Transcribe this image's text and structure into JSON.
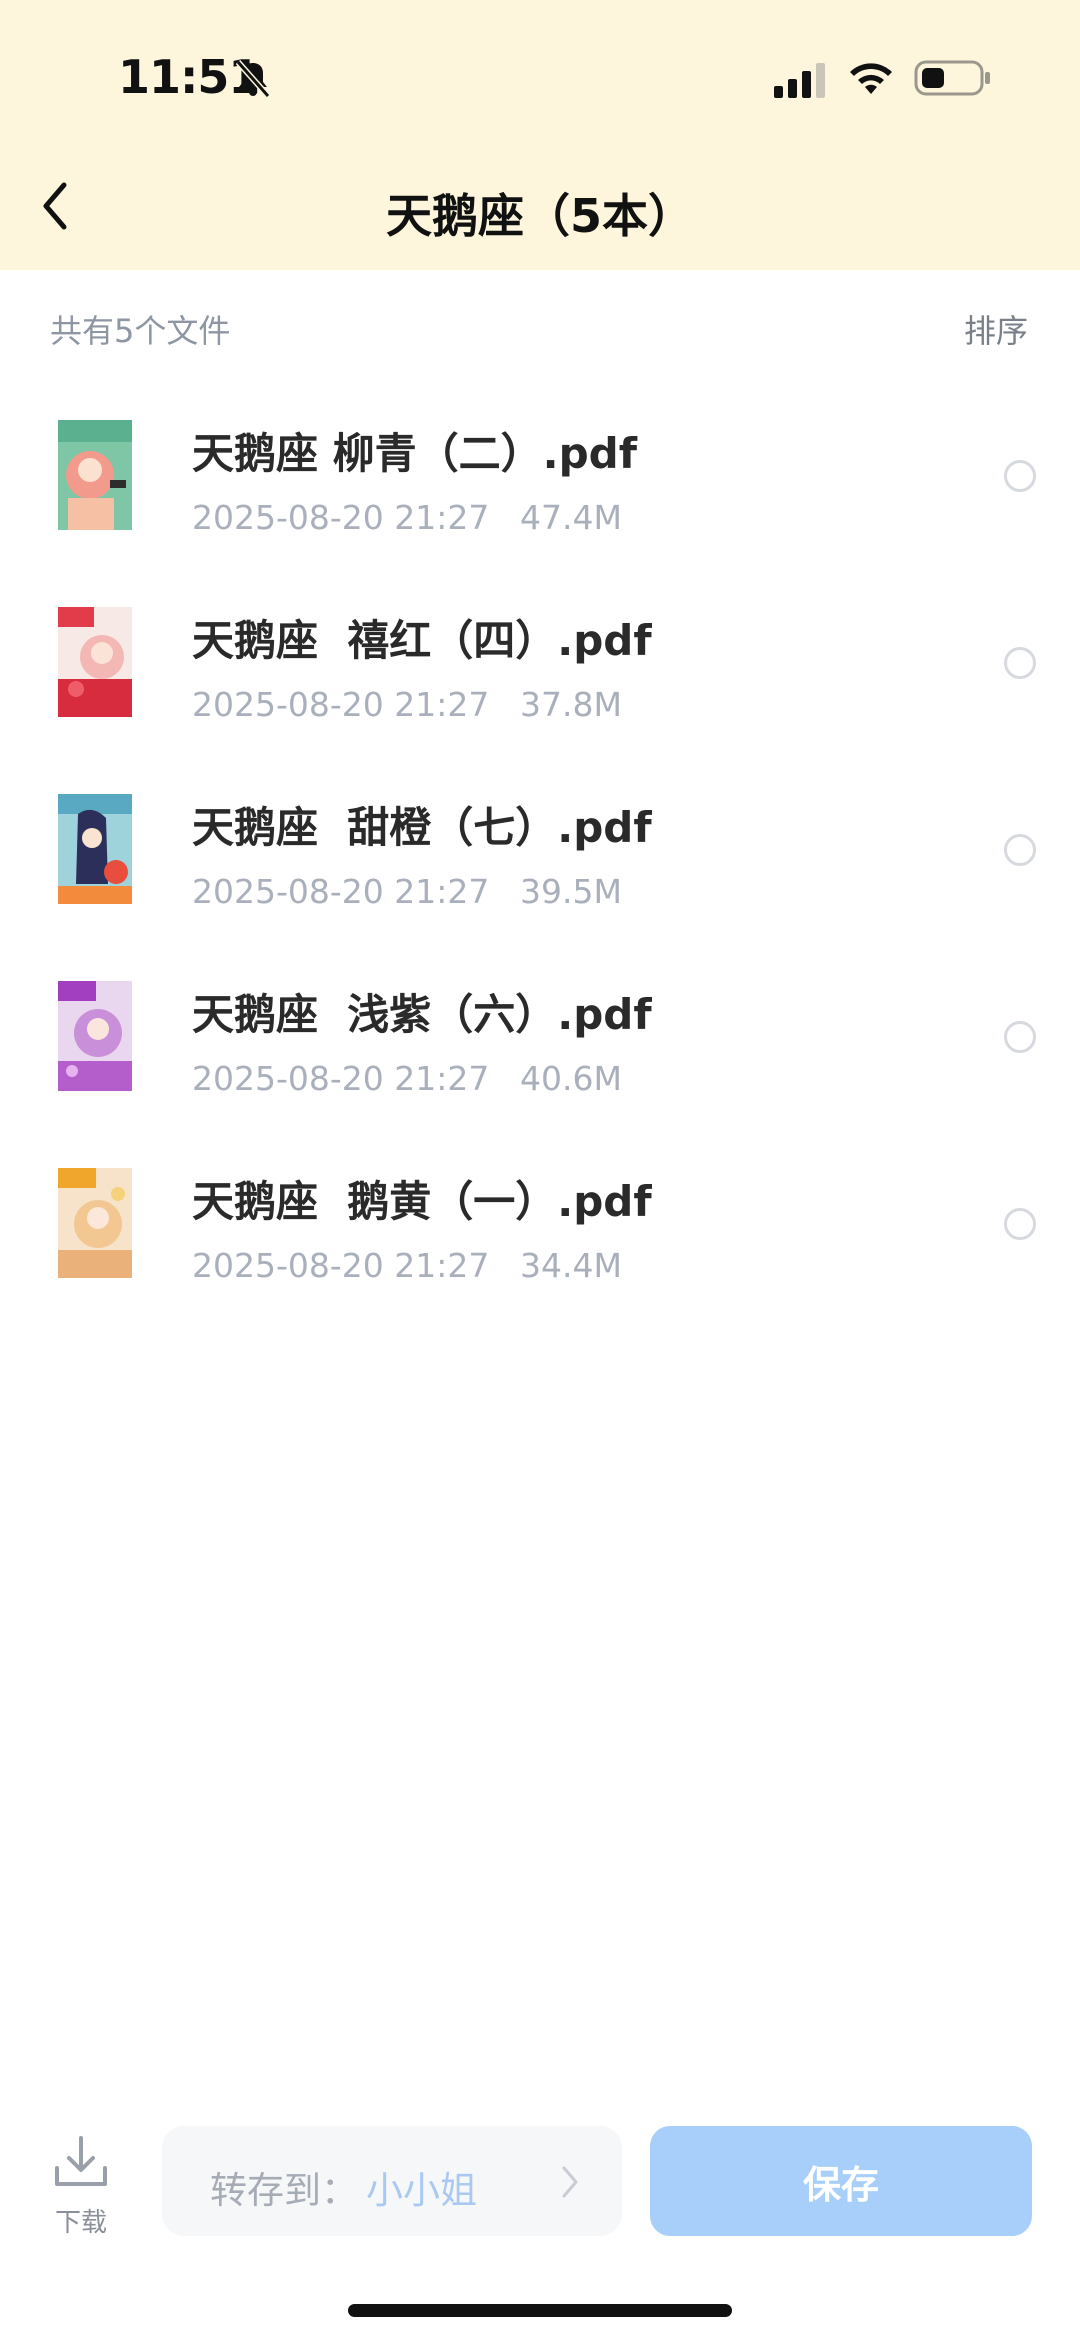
{
  "status_bar": {
    "time": "11:51"
  },
  "header": {
    "title": "天鹅座（5本）"
  },
  "summary": {
    "count_text": "共有5个文件",
    "sort_label": "排序"
  },
  "files": [
    {
      "name": "天鹅座 柳青（二）.pdf",
      "date": "2025-08-20 21:27",
      "size": "47.4M"
    },
    {
      "name": "天鹅座  禧红（四）.pdf",
      "date": "2025-08-20 21:27",
      "size": "37.8M"
    },
    {
      "name": "天鹅座  甜橙（七）.pdf",
      "date": "2025-08-20 21:27",
      "size": "39.5M"
    },
    {
      "name": "天鹅座  浅紫（六）.pdf",
      "date": "2025-08-20 21:27",
      "size": "40.6M"
    },
    {
      "name": "天鹅座  鹅黄（一）.pdf",
      "date": "2025-08-20 21:27",
      "size": "34.4M"
    }
  ],
  "bottom_bar": {
    "download_label": "下载",
    "transfer_label": "转存到：",
    "transfer_target": "小小姐",
    "save_label": "保存"
  },
  "colors": {
    "header_bg": "#fdf6dc",
    "save_button": "#a7cff9",
    "accent_text": "#a9c9f2"
  }
}
